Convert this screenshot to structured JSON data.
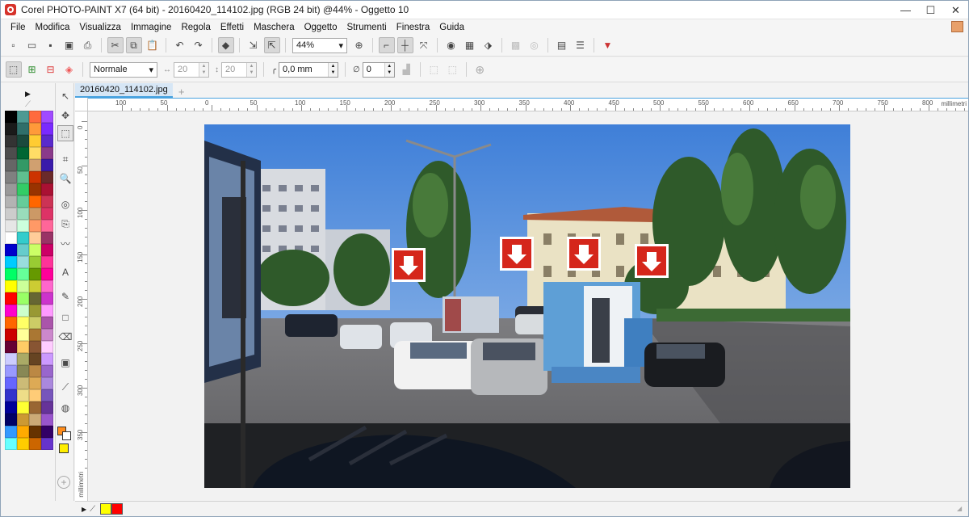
{
  "window": {
    "title": "Corel PHOTO-PAINT X7 (64 bit) - 20160420_114102.jpg (RGB 24 bit) @44% - Oggetto 10",
    "minimize": "—",
    "maximize": "☐",
    "close": "✕"
  },
  "menu": [
    "File",
    "Modifica",
    "Visualizza",
    "Immagine",
    "Regola",
    "Effetti",
    "Maschera",
    "Oggetto",
    "Strumenti",
    "Finestra",
    "Guida"
  ],
  "toolbar": {
    "zoom_value": "44%"
  },
  "property_bar": {
    "blend_mode": "Normale",
    "width_value": "20",
    "height_value": "20",
    "feather_value": "0,0 mm",
    "angle_value": "0"
  },
  "document": {
    "tab_label": "20160420_114102.jpg",
    "tab_add": "+",
    "ruler_unit": "millimetri",
    "ruler_h_labels": [
      "100",
      "50",
      "0",
      "50",
      "100",
      "150",
      "200",
      "250",
      "300",
      "350",
      "400",
      "450",
      "500",
      "550",
      "600",
      "650",
      "700",
      "750",
      "800"
    ],
    "ruler_v_labels": [
      "0",
      "50",
      "100",
      "150",
      "200",
      "250",
      "300",
      "350"
    ]
  },
  "palette_colors": [
    "#000000",
    "#4d9a93",
    "#ff6a3d",
    "#a04aff",
    "#1a1a1a",
    "#2f6f6a",
    "#ff9a3a",
    "#7a2aff",
    "#333333",
    "#1a4a3d",
    "#ffcc33",
    "#5a2acc",
    "#4d4d4d",
    "#006633",
    "#ffdd66",
    "#8a3a8a",
    "#666666",
    "#339966",
    "#d0a070",
    "#3a1aaa",
    "#808080",
    "#5fbf8f",
    "#cc3300",
    "#6a2a2a",
    "#999999",
    "#33cc66",
    "#993300",
    "#aa1133",
    "#b3b3b3",
    "#66cc99",
    "#ff6600",
    "#cc3355",
    "#cccccc",
    "#99ddbb",
    "#cc9966",
    "#dd3366",
    "#e6e6e6",
    "#ccffdd",
    "#ff9966",
    "#ff6699",
    "#ffffff",
    "#33cccc",
    "#ffcc99",
    "#993366",
    "#0000cc",
    "#66cccc",
    "#ccff66",
    "#cc0066",
    "#00ccff",
    "#99dddd",
    "#99cc33",
    "#ff3399",
    "#00ff66",
    "#66ff99",
    "#669900",
    "#ff0099",
    "#ffff00",
    "#ccff99",
    "#cccc33",
    "#ff66cc",
    "#ff0000",
    "#99ff66",
    "#666633",
    "#cc33cc",
    "#ff00cc",
    "#ccffcc",
    "#999933",
    "#ff99ff",
    "#ff6600",
    "#ffff66",
    "#cccc66",
    "#aa55aa",
    "#cc0000",
    "#ffff99",
    "#aa7733",
    "#cc88cc",
    "#660033",
    "#ffcc66",
    "#885533",
    "#ffccff",
    "#ccccff",
    "#aaaa66",
    "#664422",
    "#cc99ff",
    "#9999ff",
    "#888855",
    "#bb8844",
    "#9966cc",
    "#6666ff",
    "#ccbb77",
    "#ddaa55",
    "#aa88dd",
    "#3333cc",
    "#eedd88",
    "#ffcc77",
    "#7755bb",
    "#000099",
    "#ffff33",
    "#996633",
    "#663399",
    "#000066",
    "#cc9933",
    "#ccaa77",
    "#9955cc",
    "#3399ff",
    "#ffaa00",
    "#663300",
    "#330066",
    "#66ffff",
    "#ffcc00",
    "#cc6600",
    "#6633cc"
  ],
  "tool_icons": [
    "pick-icon",
    "transform-icon",
    "mask-icon",
    "crop-icon",
    "zoom-icon",
    "redeye-icon",
    "clone-icon",
    "smear-icon",
    "text-icon",
    "paint-icon",
    "rectangle-icon",
    "eraser-icon",
    "shadow-icon",
    "eyedropper-icon",
    "fill-icon"
  ],
  "statusbar": {
    "fill_color": "#ffff00",
    "outline_color": "#ff0000"
  }
}
